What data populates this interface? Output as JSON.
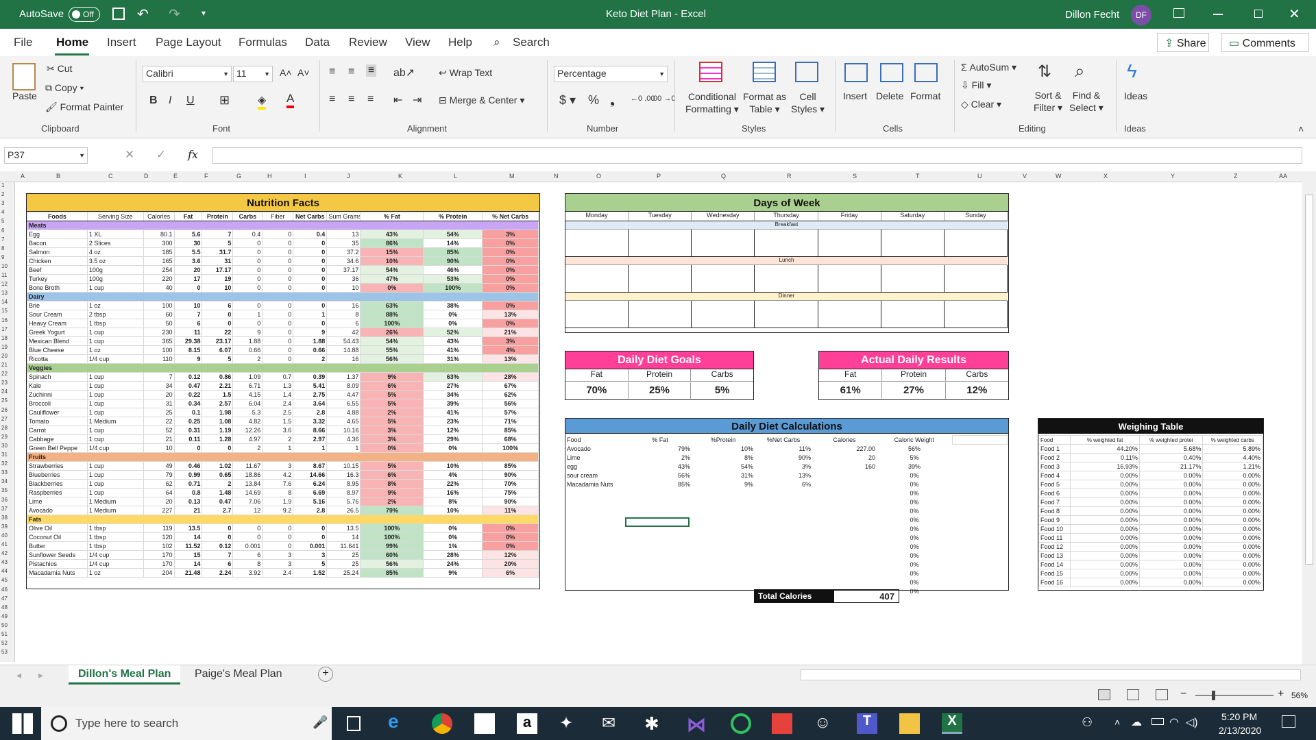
{
  "titlebar": {
    "autosave": "AutoSave",
    "autosave_state": "Off",
    "title": "Keto Diet Plan  -  Excel",
    "user": "Dillon Fecht",
    "initials": "DF"
  },
  "menu": {
    "file": "File",
    "home": "Home",
    "insert": "Insert",
    "page_layout": "Page Layout",
    "formulas": "Formulas",
    "data": "Data",
    "review": "Review",
    "view": "View",
    "help": "Help",
    "search": "Search",
    "share": "Share",
    "comments": "Comments"
  },
  "ribbon": {
    "paste": "Paste",
    "cut": "Cut",
    "copy": "Copy",
    "format_painter": "Format Painter",
    "font_name": "Calibri",
    "font_size": "11",
    "wrap_text": "Wrap Text",
    "merge_center": "Merge & Center",
    "number_format": "Percentage",
    "conditional1": "Conditional",
    "conditional2": "Formatting",
    "format_as1": "Format as",
    "format_as2": "Table",
    "cell1": "Cell",
    "cell2": "Styles",
    "insert": "Insert",
    "delete": "Delete",
    "format": "Format",
    "autosum": "AutoSum",
    "fill": "Fill",
    "clear": "Clear",
    "sort1": "Sort &",
    "sort2": "Filter",
    "find1": "Find &",
    "find2": "Select",
    "ideas": "Ideas",
    "groups": {
      "clipboard": "Clipboard",
      "font": "Font",
      "alignment": "Alignment",
      "number": "Number",
      "styles": "Styles",
      "cells": "Cells",
      "editing": "Editing",
      "ideas": "Ideas"
    }
  },
  "formula_bar": {
    "name_box": "P37",
    "fx": "fx"
  },
  "columns": [
    "A",
    "B",
    "C",
    "D",
    "E",
    "F",
    "G",
    "H",
    "I",
    "J",
    "K",
    "L",
    "M",
    "N",
    "O",
    "P",
    "Q",
    "R",
    "S",
    "T",
    "U",
    "V",
    "W",
    "X",
    "Y",
    "Z",
    "AA"
  ],
  "nutrition": {
    "title": "Nutrition Facts",
    "headers": [
      "Foods",
      "Serving Size",
      "Calories",
      "Fat",
      "Protein",
      "Carbs",
      "Fiber",
      "Net Carbs",
      "Sum Grams",
      "% Fat",
      "% Protein",
      "% Net Carbs"
    ],
    "groups": [
      {
        "name": "Meats",
        "rows": [
          [
            "Egg",
            "1 XL",
            "80.1",
            "5.6",
            "7",
            "0.4",
            "0",
            "0.4",
            "13",
            "43%",
            "54%",
            "3%"
          ],
          [
            "Bacon",
            "2 Slices",
            "300",
            "30",
            "5",
            "0",
            "0",
            "0",
            "35",
            "86%",
            "14%",
            "0%"
          ],
          [
            "Salmon",
            "4 oz",
            "185",
            "5.5",
            "31.7",
            "0",
            "0",
            "0",
            "37.2",
            "15%",
            "85%",
            "0%"
          ],
          [
            "Chicken",
            "3.5 oz",
            "165",
            "3.6",
            "31",
            "0",
            "0",
            "0",
            "34.6",
            "10%",
            "90%",
            "0%"
          ],
          [
            "Beef",
            "100g",
            "254",
            "20",
            "17.17",
            "0",
            "0",
            "0",
            "37.17",
            "54%",
            "46%",
            "0%"
          ],
          [
            "Turkey",
            "100g",
            "220",
            "17",
            "19",
            "0",
            "0",
            "0",
            "36",
            "47%",
            "53%",
            "0%"
          ],
          [
            "Bone Broth",
            "1 cup",
            "40",
            "0",
            "10",
            "0",
            "0",
            "0",
            "10",
            "0%",
            "100%",
            "0%"
          ]
        ]
      },
      {
        "name": "Dairy",
        "rows": [
          [
            "Brie",
            "1 oz",
            "100",
            "10",
            "6",
            "0",
            "0",
            "0",
            "16",
            "63%",
            "38%",
            "0%"
          ],
          [
            "Sour Cream",
            "2 tbsp",
            "60",
            "7",
            "0",
            "1",
            "0",
            "1",
            "8",
            "88%",
            "0%",
            "13%"
          ],
          [
            "Heavy Cream",
            "1 tbsp",
            "50",
            "6",
            "0",
            "0",
            "0",
            "0",
            "6",
            "100%",
            "0%",
            "0%"
          ],
          [
            "Greek Yogurt",
            "1 cup",
            "230",
            "11",
            "22",
            "9",
            "0",
            "9",
            "42",
            "26%",
            "52%",
            "21%"
          ],
          [
            "Mexican Blend",
            "1 cup",
            "365",
            "29.38",
            "23.17",
            "1.88",
            "0",
            "1.88",
            "54.43",
            "54%",
            "43%",
            "3%"
          ],
          [
            "Blue Cheese",
            "1 oz",
            "100",
            "8.15",
            "6.07",
            "0.66",
            "0",
            "0.66",
            "14.88",
            "55%",
            "41%",
            "4%"
          ],
          [
            "Ricotta",
            "1/4 cup",
            "110",
            "9",
            "5",
            "2",
            "0",
            "2",
            "16",
            "56%",
            "31%",
            "13%"
          ]
        ]
      },
      {
        "name": "Veggies",
        "rows": [
          [
            "Spinach",
            "1 cup",
            "7",
            "0.12",
            "0.86",
            "1.09",
            "0.7",
            "0.39",
            "1.37",
            "9%",
            "63%",
            "28%"
          ],
          [
            "Kale",
            "1 cup",
            "34",
            "0.47",
            "2.21",
            "6.71",
            "1.3",
            "5.41",
            "8.09",
            "6%",
            "27%",
            "67%"
          ],
          [
            "Zuchinni",
            "1 cup",
            "20",
            "0.22",
            "1.5",
            "4.15",
            "1.4",
            "2.75",
            "4.47",
            "5%",
            "34%",
            "62%"
          ],
          [
            "Broccoli",
            "1 cup",
            "31",
            "0.34",
            "2.57",
            "6.04",
            "2.4",
            "3.64",
            "6.55",
            "5%",
            "39%",
            "56%"
          ],
          [
            "Cauliflower",
            "1 cup",
            "25",
            "0.1",
            "1.98",
            "5.3",
            "2.5",
            "2.8",
            "4.88",
            "2%",
            "41%",
            "57%"
          ],
          [
            "Tomato",
            "1 Medium",
            "22",
            "0.25",
            "1.08",
            "4.82",
            "1.5",
            "3.32",
            "4.65",
            "5%",
            "23%",
            "71%"
          ],
          [
            "Carrot",
            "1 cup",
            "52",
            "0.31",
            "1.19",
            "12.26",
            "3.6",
            "8.66",
            "10.16",
            "3%",
            "12%",
            "85%"
          ],
          [
            "Cabbage",
            "1 cup",
            "21",
            "0.11",
            "1.28",
            "4.97",
            "2",
            "2.97",
            "4.36",
            "3%",
            "29%",
            "68%"
          ],
          [
            "Green Bell Peppe",
            "1/4 cup",
            "10",
            "0",
            "0",
            "2",
            "1",
            "1",
            "1",
            "0%",
            "0%",
            "100%"
          ]
        ]
      },
      {
        "name": "Fruits",
        "rows": [
          [
            "Strawberries",
            "1 cup",
            "49",
            "0.46",
            "1.02",
            "11.67",
            "3",
            "8.67",
            "10.15",
            "5%",
            "10%",
            "85%"
          ],
          [
            "Blueberries",
            "1 cup",
            "79",
            "0.99",
            "0.65",
            "18.86",
            "4.2",
            "14.66",
            "16.3",
            "6%",
            "4%",
            "90%"
          ],
          [
            "Blackberries",
            "1 cup",
            "62",
            "0.71",
            "2",
            "13.84",
            "7.6",
            "6.24",
            "8.95",
            "8%",
            "22%",
            "70%"
          ],
          [
            "Raspberries",
            "1 cup",
            "64",
            "0.8",
            "1.48",
            "14.69",
            "8",
            "6.69",
            "8.97",
            "9%",
            "16%",
            "75%"
          ],
          [
            "Lime",
            "1 Medium",
            "20",
            "0.13",
            "0.47",
            "7.06",
            "1.9",
            "5.16",
            "5.76",
            "2%",
            "8%",
            "90%"
          ],
          [
            "Avocado",
            "1 Medium",
            "227",
            "21",
            "2.7",
            "12",
            "9.2",
            "2.8",
            "26.5",
            "79%",
            "10%",
            "11%"
          ]
        ]
      },
      {
        "name": "Fats",
        "rows": [
          [
            "Olive Oil",
            "1 tbsp",
            "119",
            "13.5",
            "0",
            "0",
            "0",
            "0",
            "13.5",
            "100%",
            "0%",
            "0%"
          ],
          [
            "Coconut Oil",
            "1 tbsp",
            "120",
            "14",
            "0",
            "0",
            "0",
            "0",
            "14",
            "100%",
            "0%",
            "0%"
          ],
          [
            "Butter",
            "1 tbsp",
            "102",
            "11.52",
            "0.12",
            "0.001",
            "0",
            "0.001",
            "11.641",
            "99%",
            "1%",
            "0%"
          ],
          [
            "Sunflower Seeds",
            "1/4 cup",
            "170",
            "15",
            "7",
            "6",
            "3",
            "3",
            "25",
            "60%",
            "28%",
            "12%"
          ],
          [
            "Pistachios",
            "1/4 cup",
            "170",
            "14",
            "6",
            "8",
            "3",
            "5",
            "25",
            "56%",
            "24%",
            "20%"
          ],
          [
            "Macadamia Nuts",
            "1 oz",
            "204",
            "21.48",
            "2.24",
            "3.92",
            "2.4",
            "1.52",
            "25.24",
            "85%",
            "9%",
            "6%"
          ]
        ]
      }
    ]
  },
  "days": {
    "title": "Days of Week",
    "days": [
      "Monday",
      "Tuesday",
      "Wednesday",
      "Thursday",
      "Friday",
      "Saturday",
      "Sunday"
    ],
    "meals": [
      "Breakfast",
      "Lunch",
      "Dinner"
    ]
  },
  "goals": {
    "title": "Daily Diet Goals",
    "labels": [
      "Fat",
      "Protein",
      "Carbs"
    ],
    "values": [
      "70%",
      "25%",
      "5%"
    ]
  },
  "actual": {
    "title": "Actual Daily Results",
    "labels": [
      "Fat",
      "Protein",
      "Carbs"
    ],
    "values": [
      "61%",
      "27%",
      "12%"
    ]
  },
  "calc": {
    "title": "Daily Diet Calculations",
    "headers": [
      "Food",
      "% Fat",
      "%Protein",
      "%Net Carbs",
      "Calories",
      "Caloric Weight"
    ],
    "rows": [
      [
        "Avocado",
        "79%",
        "10%",
        "11%",
        "227.00",
        "56%"
      ],
      [
        "Lime",
        "2%",
        "8%",
        "90%",
        "20",
        "5%"
      ],
      [
        "egg",
        "43%",
        "54%",
        "3%",
        "160",
        "39%"
      ],
      [
        "sour cream",
        "56%",
        "31%",
        "13%",
        "",
        "0%"
      ],
      [
        "Macadamia Nuts",
        "85%",
        "9%",
        "6%",
        "",
        "0%"
      ],
      [
        "",
        "",
        "",
        "",
        "",
        "0%"
      ],
      [
        "",
        "",
        "",
        "",
        "",
        "0%"
      ],
      [
        "",
        "",
        "",
        "",
        "",
        "0%"
      ],
      [
        "",
        "",
        "",
        "",
        "",
        "0%"
      ],
      [
        "",
        "",
        "",
        "",
        "",
        "0%"
      ],
      [
        "",
        "",
        "",
        "",
        "",
        "0%"
      ],
      [
        "",
        "",
        "",
        "",
        "",
        "0%"
      ],
      [
        "",
        "",
        "",
        "",
        "",
        "0%"
      ],
      [
        "",
        "",
        "",
        "",
        "",
        "0%"
      ],
      [
        "",
        "",
        "",
        "",
        "",
        "0%"
      ],
      [
        "",
        "",
        "",
        "",
        "",
        "0%"
      ],
      [
        "",
        "",
        "",
        "",
        "",
        "0%"
      ]
    ],
    "total_label": "Total Calories",
    "total_value": "407"
  },
  "weighing": {
    "title": "Weighing Table",
    "headers": [
      "Food",
      "% weighted fat",
      "% weighted protei",
      "% weighted carbs"
    ],
    "rows": [
      [
        "Food 1",
        "44.20%",
        "5.68%",
        "5.89%"
      ],
      [
        "Food 2",
        "0.11%",
        "0.40%",
        "4.40%"
      ],
      [
        "Food 3",
        "16.93%",
        "21.17%",
        "1.21%"
      ],
      [
        "Food 4",
        "0.00%",
        "0.00%",
        "0.00%"
      ],
      [
        "Food 5",
        "0.00%",
        "0.00%",
        "0.00%"
      ],
      [
        "Food 6",
        "0.00%",
        "0.00%",
        "0.00%"
      ],
      [
        "Food 7",
        "0.00%",
        "0.00%",
        "0.00%"
      ],
      [
        "Food 8",
        "0.00%",
        "0.00%",
        "0.00%"
      ],
      [
        "Food 9",
        "0.00%",
        "0.00%",
        "0.00%"
      ],
      [
        "Food 10",
        "0.00%",
        "0.00%",
        "0.00%"
      ],
      [
        "Food 11",
        "0.00%",
        "0.00%",
        "0.00%"
      ],
      [
        "Food 12",
        "0.00%",
        "0.00%",
        "0.00%"
      ],
      [
        "Food 13",
        "0.00%",
        "0.00%",
        "0.00%"
      ],
      [
        "Food 14",
        "0.00%",
        "0.00%",
        "0.00%"
      ],
      [
        "Food 15",
        "0.00%",
        "0.00%",
        "0.00%"
      ],
      [
        "Food 16",
        "0.00%",
        "0.00%",
        "0.00%"
      ]
    ]
  },
  "sheets": {
    "active": "Dillon's Meal Plan",
    "other": "Paige's Meal Plan"
  },
  "status": {
    "zoom": "56%"
  },
  "taskbar": {
    "search": "Type here to search",
    "time": "5:20 PM",
    "date": "2/13/2020"
  },
  "colors": {
    "excel_green": "#217346",
    "yellow_header": "#f4c842",
    "green_header": "#a9d08e",
    "pink_header": "#ff3f98",
    "blue_header": "#5b9bd5",
    "purple_cat": "#c9a6f5"
  }
}
